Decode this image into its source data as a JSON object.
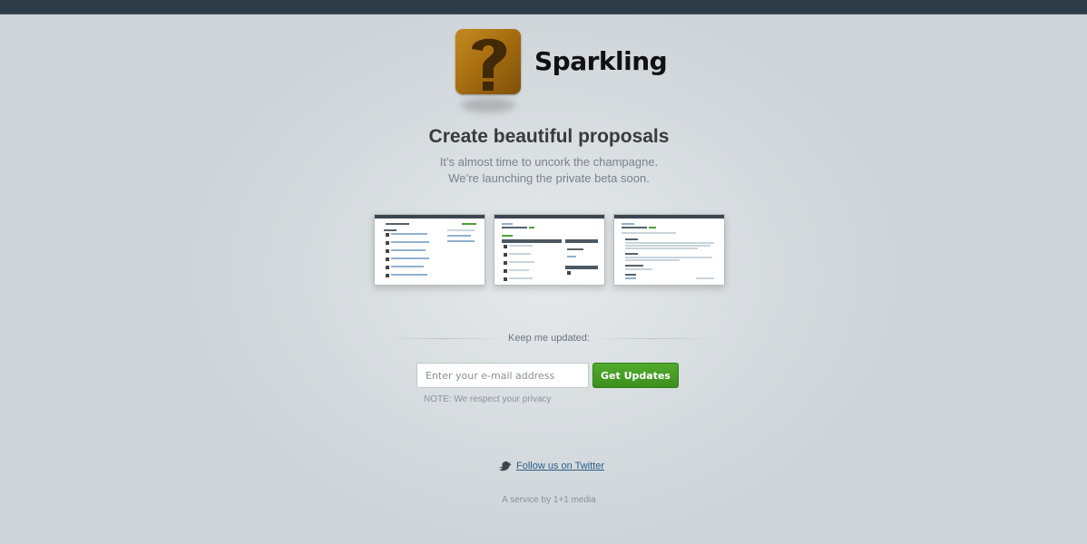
{
  "brand": {
    "name": "Sparkling",
    "logo_icon": "question-mark-icon"
  },
  "hero": {
    "headline": "Create beautiful proposals",
    "subtext_line1": "It’s almost time to uncork the champagne.",
    "subtext_line2": "We’re launching the private beta soon."
  },
  "screenshots": [
    {
      "name": "dashboard-preview"
    },
    {
      "name": "project-preview"
    },
    {
      "name": "proposal-preview"
    }
  ],
  "signup": {
    "label": "Keep me updated:",
    "email_placeholder": "Enter your e-mail address",
    "email_value": "",
    "submit_label": "Get Updates",
    "note": "NOTE: We respect your privacy"
  },
  "social": {
    "icon": "twitter-bird-icon",
    "link_text": "Follow us on Twitter"
  },
  "footer": {
    "text": "A service by 1+1 media"
  },
  "colors": {
    "topbar": "#2e3c47",
    "button": "#3c8f1c",
    "link": "#2a5d8a",
    "logo": "#a96f10"
  }
}
